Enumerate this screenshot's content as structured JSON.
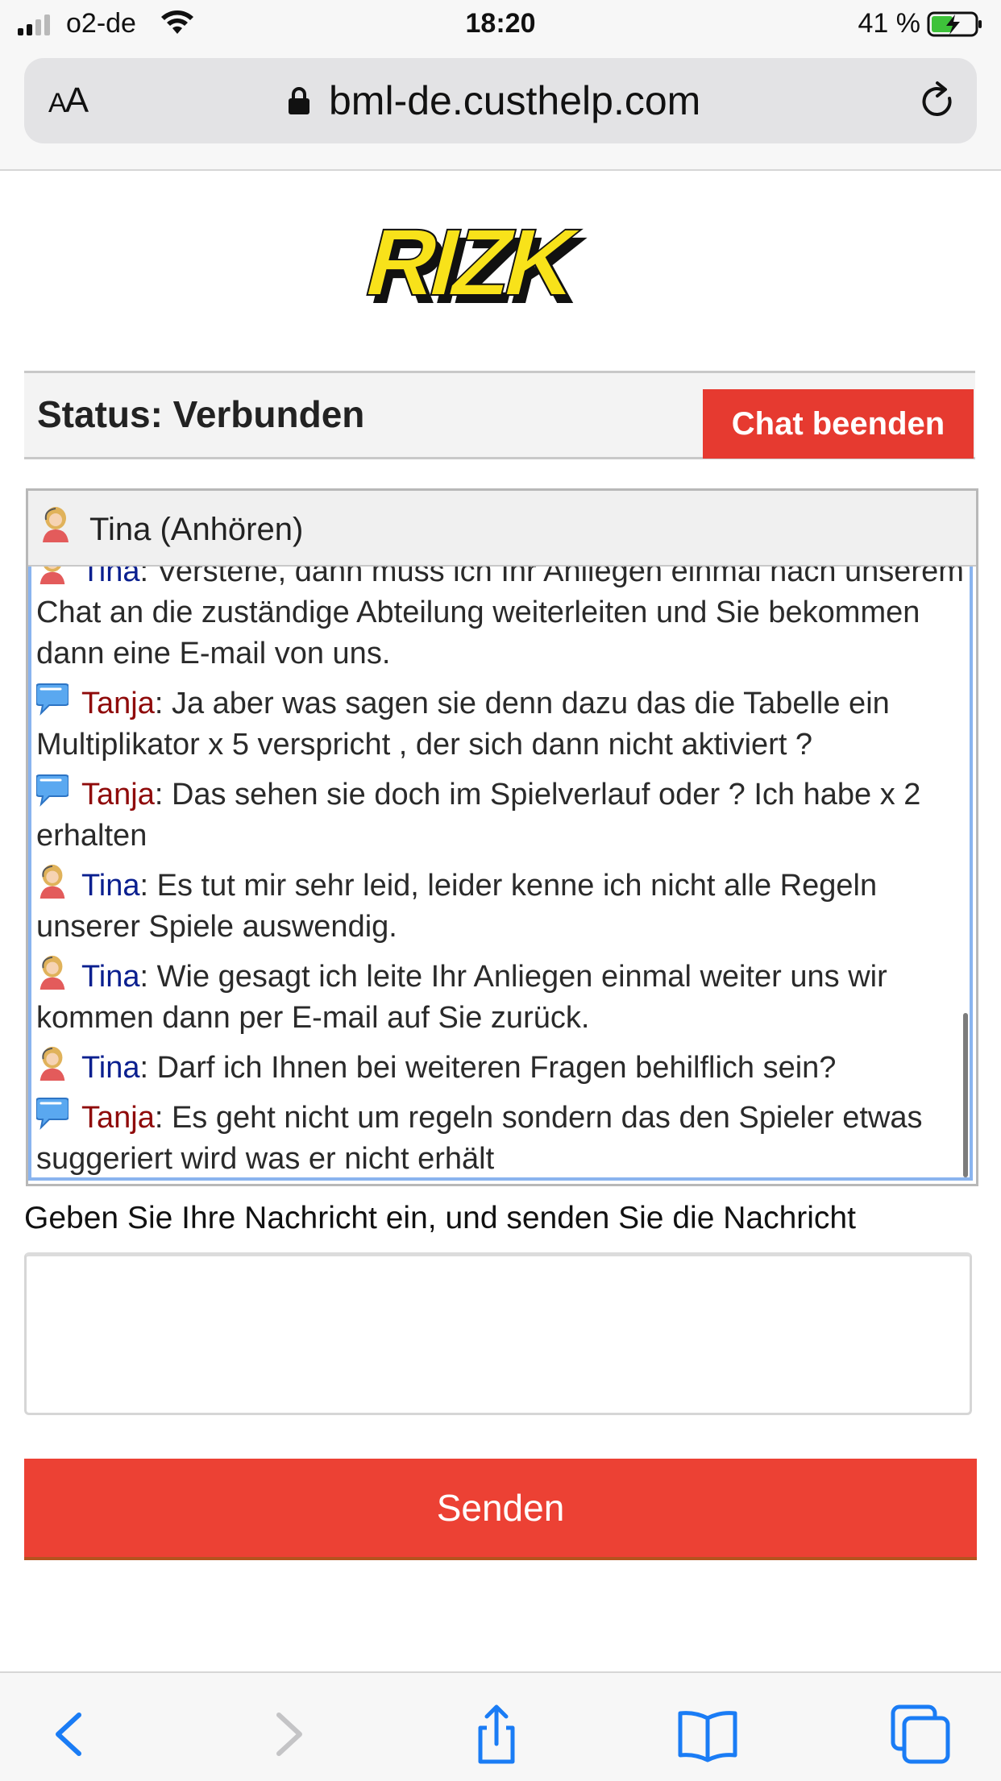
{
  "status_bar": {
    "carrier": "o2-de",
    "time": "18:20",
    "battery_percent": "41 %"
  },
  "browser": {
    "text_size_label": "AA",
    "url": "bml-de.custhelp.com"
  },
  "brand": {
    "logo_text": "RIZK",
    "logo_color": "#f8e21a"
  },
  "status": {
    "label": "Status: Verbunden",
    "end_chat_label": "Chat beenden"
  },
  "chat": {
    "header_label": "Tina (Anhören)",
    "messages": [
      {
        "sender": "Tina",
        "role": "agent",
        "text": ": Verstehe, dann muss ich Ihr Anliegen einmal nach unserem Chat an die zuständige Abteilung weiterleiten und Sie bekommen dann eine E-mail von uns."
      },
      {
        "sender": "Tanja",
        "role": "user",
        "text": ": Ja aber was sagen sie denn dazu das die Tabelle ein Multiplikator x 5 verspricht , der sich dann nicht aktiviert ?"
      },
      {
        "sender": "Tanja",
        "role": "user",
        "text": ": Das sehen sie doch im Spielverlauf oder ? Ich habe x 2 erhalten"
      },
      {
        "sender": "Tina",
        "role": "agent",
        "text": ": Es tut mir sehr leid, leider kenne ich nicht alle Regeln unserer Spiele auswendig."
      },
      {
        "sender": "Tina",
        "role": "agent",
        "text": ": Wie gesagt ich leite Ihr Anliegen einmal weiter uns wir kommen dann per E-mail auf Sie zurück."
      },
      {
        "sender": "Tina",
        "role": "agent",
        "text": ": Darf ich Ihnen bei weiteren Fragen behilflich sein?"
      },
      {
        "sender": "Tanja",
        "role": "user",
        "text": ": Es geht nicht um regeln sondern das den Spieler etwas suggeriert wird was er nicht erhält"
      }
    ]
  },
  "compose": {
    "prompt": "Geben Sie Ihre Nachricht ein, und senden Sie die Nachricht",
    "input_value": "",
    "send_label": "Senden"
  },
  "colors": {
    "accent_red": "#e63a30",
    "agent_name": "#0a1f8f",
    "user_name": "#8f0a0a",
    "ios_blue": "#1a7cf5"
  }
}
